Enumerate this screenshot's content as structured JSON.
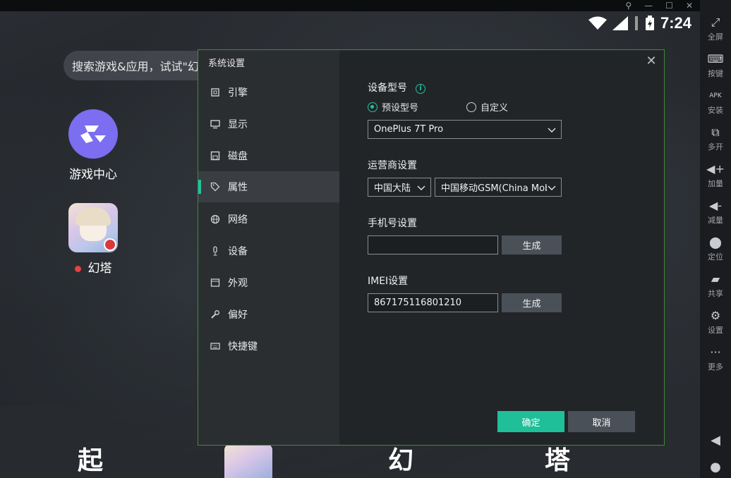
{
  "status_bar": {
    "time": "7:24"
  },
  "search": {
    "placeholder": "搜索游戏&应用，试试\"幻"
  },
  "desktop_apps": [
    {
      "label": "游戏中心"
    },
    {
      "label": "幻塔"
    }
  ],
  "dock": {
    "items": [
      "起",
      "幻",
      "塔"
    ]
  },
  "sidebar": {
    "items": [
      {
        "label": "全屏",
        "icon": "fullscreen-icon"
      },
      {
        "label": "按键",
        "icon": "keyboard-icon"
      },
      {
        "label": "安装",
        "icon": "apk-icon"
      },
      {
        "label": "多开",
        "icon": "multi-instance-icon"
      },
      {
        "label": "加量",
        "icon": "volume-up-icon"
      },
      {
        "label": "减量",
        "icon": "volume-down-icon"
      },
      {
        "label": "定位",
        "icon": "location-icon"
      },
      {
        "label": "共享",
        "icon": "folder-icon"
      },
      {
        "label": "设置",
        "icon": "gear-icon"
      },
      {
        "label": "更多",
        "icon": "more-icon"
      }
    ]
  },
  "dialog": {
    "title": "系统设置",
    "menu": [
      {
        "label": "引擎",
        "icon": "chip-icon"
      },
      {
        "label": "显示",
        "icon": "monitor-icon"
      },
      {
        "label": "磁盘",
        "icon": "disk-icon"
      },
      {
        "label": "属性",
        "icon": "tag-icon",
        "active": true
      },
      {
        "label": "网络",
        "icon": "globe-icon"
      },
      {
        "label": "设备",
        "icon": "microphone-icon"
      },
      {
        "label": "外观",
        "icon": "window-icon"
      },
      {
        "label": "偏好",
        "icon": "wrench-icon"
      },
      {
        "label": "快捷键",
        "icon": "keyboard-icon"
      }
    ],
    "device_model": {
      "label": "设备型号",
      "option_preset": "预设型号",
      "option_custom": "自定义",
      "selected": "预设型号",
      "model_value": "OnePlus 7T Pro"
    },
    "carrier": {
      "label": "运营商设置",
      "country": "中国大陆",
      "operator": "中国移动GSM(China Mobi"
    },
    "phone": {
      "label": "手机号设置",
      "value": "",
      "generate": "生成"
    },
    "imei": {
      "label": "IMEI设置",
      "value": "867175116801210",
      "generate": "生成"
    },
    "confirm": "确定",
    "cancel": "取消"
  }
}
